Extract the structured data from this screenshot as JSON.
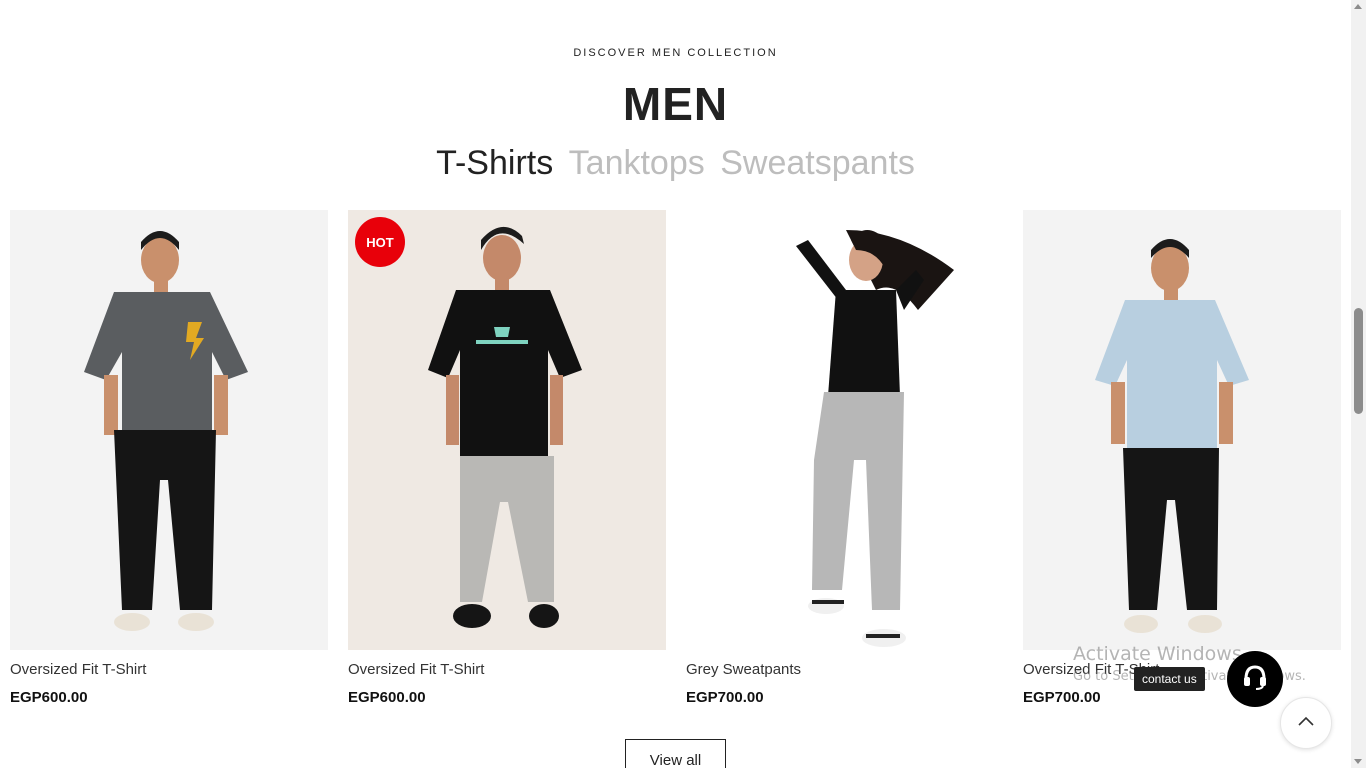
{
  "section": {
    "eyebrow": "DISCOVER MEN COLLECTION",
    "title": "MEN",
    "tabs": [
      {
        "label": "T-Shirts",
        "active": true
      },
      {
        "label": "Tanktops",
        "active": false
      },
      {
        "label": "Sweatspants",
        "active": false
      }
    ]
  },
  "products": [
    {
      "name": "Oversized Fit T-Shirt",
      "price": "EGP600.00",
      "badge": "",
      "tee_color": "#5a5d60",
      "pants_color": "#151515",
      "bg": "#f3f3f3"
    },
    {
      "name": "Oversized Fit T-Shirt",
      "price": "EGP600.00",
      "badge": "HOT",
      "tee_color": "#111111",
      "pants_color": "#b9b8b5",
      "bg": "#efe9e3"
    },
    {
      "name": "Grey Sweatpants",
      "price": "EGP700.00",
      "badge": "",
      "tee_color": "#111111",
      "pants_color": "#b7b7b7",
      "bg": "#ffffff"
    },
    {
      "name": "Oversized Fit T-Shirt",
      "price": "EGP700.00",
      "badge": "",
      "tee_color": "#b8cfe0",
      "pants_color": "#151515",
      "bg": "#f3f3f3"
    }
  ],
  "view_all_label": "View all",
  "contact": {
    "label": "contact us"
  },
  "watermark": {
    "line1": "Activate Windows",
    "line2": "Go to Settings to activate Windows."
  },
  "icons": {
    "contact": "headset-icon",
    "back_to_top": "chevron-up-icon"
  }
}
